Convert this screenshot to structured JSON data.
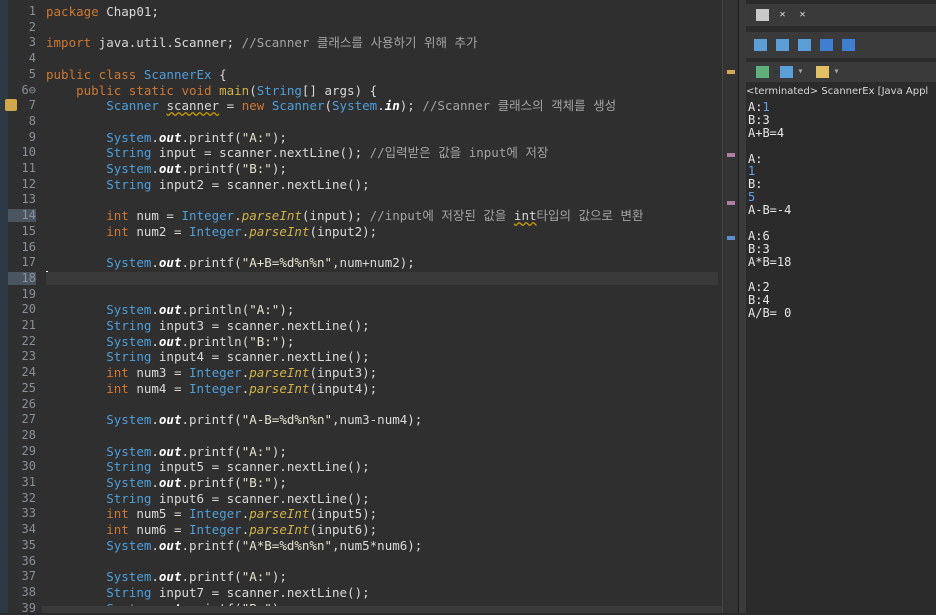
{
  "editor": {
    "lines": [
      {
        "n": "1",
        "code": "<span class=\"kw\">package</span> Chap01;"
      },
      {
        "n": "2",
        "code": ""
      },
      {
        "n": "3",
        "code": "<span class=\"kw\">import</span> java.util.Scanner; <span class=\"cm\">//Scanner 클래스를 사용하기 위해 추가</span>"
      },
      {
        "n": "4",
        "code": ""
      },
      {
        "n": "5",
        "code": "<span class=\"kw\">public class</span> <span class=\"ty\">ScannerEx</span> {"
      },
      {
        "n": "6⊖",
        "code": "    <span class=\"kw\">public static void</span> <span class=\"fn\">main</span>(<span class=\"ty\">String</span>[] args) {"
      },
      {
        "n": "7",
        "code": "        <span class=\"ty\">Scanner</span> <span class=\"var\">scanner</span> = <span class=\"kw\">new</span> <span class=\"ty\">Scanner</span>(<span class=\"ty\">System</span>.<span class=\"it\">in</span>); <span class=\"cm\">//Scanner 클래스의 객체를 생성</span>"
      },
      {
        "n": "8",
        "code": ""
      },
      {
        "n": "9",
        "code": "        <span class=\"ty\">System</span>.<span class=\"it\">out</span>.printf(<span class=\"st\">\"A:\"</span>);"
      },
      {
        "n": "10",
        "code": "        <span class=\"ty\">String</span> input = scanner.nextLine(); <span class=\"cm\">//입력받은 값을 input에 저장</span>"
      },
      {
        "n": "11",
        "code": "        <span class=\"ty\">System</span>.<span class=\"it\">out</span>.printf(<span class=\"st\">\"B:\"</span>);"
      },
      {
        "n": "12",
        "code": "        <span class=\"ty\">String</span> input2 = scanner.nextLine();"
      },
      {
        "n": "13",
        "code": ""
      },
      {
        "n": "14",
        "code": "        <span class=\"kw\">int</span> num = <span class=\"ty\">Integer</span>.<span class=\"it2\">parseInt</span>(input); <span class=\"cm\">//input에 저장된 값을 <span class=\"var\">int</span>타입의 값으로 변환</span>"
      },
      {
        "n": "15",
        "code": "        <span class=\"kw\">int</span> num2 = <span class=\"ty\">Integer</span>.<span class=\"it2\">parseInt</span>(input2);"
      },
      {
        "n": "16",
        "code": ""
      },
      {
        "n": "17",
        "code": "        <span class=\"ty\">System</span>.<span class=\"it\">out</span>.printf(<span class=\"st\">\"A+B=%d%n%n\"</span>,num+num2);"
      },
      {
        "n": "18",
        "code": "",
        "cur": true
      },
      {
        "n": "19",
        "code": ""
      },
      {
        "n": "20",
        "code": "        <span class=\"ty\">System</span>.<span class=\"it\">out</span>.println(<span class=\"st\">\"A:\"</span>);"
      },
      {
        "n": "21",
        "code": "        <span class=\"ty\">String</span> input3 = scanner.nextLine();"
      },
      {
        "n": "22",
        "code": "        <span class=\"ty\">System</span>.<span class=\"it\">out</span>.println(<span class=\"st\">\"B:\"</span>);"
      },
      {
        "n": "23",
        "code": "        <span class=\"ty\">String</span> input4 = scanner.nextLine();"
      },
      {
        "n": "24",
        "code": "        <span class=\"kw\">int</span> num3 = <span class=\"ty\">Integer</span>.<span class=\"it2\">parseInt</span>(input3);"
      },
      {
        "n": "25",
        "code": "        <span class=\"kw\">int</span> num4 = <span class=\"ty\">Integer</span>.<span class=\"it2\">parseInt</span>(input4);"
      },
      {
        "n": "26",
        "code": ""
      },
      {
        "n": "27",
        "code": "        <span class=\"ty\">System</span>.<span class=\"it\">out</span>.printf(<span class=\"st\">\"A-B=%d%n%n\"</span>,num3-num4);"
      },
      {
        "n": "28",
        "code": ""
      },
      {
        "n": "29",
        "code": "        <span class=\"ty\">System</span>.<span class=\"it\">out</span>.printf(<span class=\"st\">\"A:\"</span>);"
      },
      {
        "n": "30",
        "code": "        <span class=\"ty\">String</span> input5 = scanner.nextLine();"
      },
      {
        "n": "31",
        "code": "        <span class=\"ty\">System</span>.<span class=\"it\">out</span>.printf(<span class=\"st\">\"B:\"</span>);"
      },
      {
        "n": "32",
        "code": "        <span class=\"ty\">String</span> input6 = scanner.nextLine();"
      },
      {
        "n": "33",
        "code": "        <span class=\"kw\">int</span> num5 = <span class=\"ty\">Integer</span>.<span class=\"it2\">parseInt</span>(input5);"
      },
      {
        "n": "34",
        "code": "        <span class=\"kw\">int</span> num6 = <span class=\"ty\">Integer</span>.<span class=\"it2\">parseInt</span>(input6);"
      },
      {
        "n": "35",
        "code": "        <span class=\"ty\">System</span>.<span class=\"it\">out</span>.printf(<span class=\"st\">\"A*B=%d%n%n\"</span>,num5*num6);"
      },
      {
        "n": "36",
        "code": ""
      },
      {
        "n": "37",
        "code": "        <span class=\"ty\">System</span>.<span class=\"it\">out</span>.printf(<span class=\"st\">\"A:\"</span>);"
      },
      {
        "n": "38",
        "code": "        <span class=\"ty\">String</span> input7 = scanner.nextLine();"
      },
      {
        "n": "39",
        "code": "        <span class=\"ty\">System</span>.<span class=\"it\">out</span>.printf(<span class=\"st\">\"B:\"</span>);"
      }
    ]
  },
  "console": {
    "status": "<terminated> ScannerEx [Java Appl",
    "output": [
      {
        "t": "A:",
        "in": false
      },
      {
        "t": "1",
        "in": true,
        "prefix": "A:"
      },
      {
        "t": "B:3",
        "in": false
      },
      {
        "t": "A+B=4",
        "in": false
      },
      {
        "t": "",
        "in": false
      },
      {
        "t": "A:",
        "in": false
      },
      {
        "t": "1",
        "in": true
      },
      {
        "t": "B:",
        "in": false
      },
      {
        "t": "5",
        "in": true
      },
      {
        "t": "A-B=-4",
        "in": false
      },
      {
        "t": "",
        "in": false
      },
      {
        "t": "A:6",
        "in": false
      },
      {
        "t": "B:3",
        "in": false
      },
      {
        "t": "A*B=18",
        "in": false
      },
      {
        "t": "",
        "in": false
      },
      {
        "t": "A:2",
        "in": false
      },
      {
        "t": "B:4",
        "in": false
      },
      {
        "t": "A/B= 0",
        "in": false
      }
    ],
    "toolbar_icons": [
      "stop-icon",
      "remove-launch-icon",
      "remove-all-icon",
      "scroll-lock-icon",
      "word-wrap-icon",
      "show-console-icon",
      "pin-console-icon",
      "display-selected-icon",
      "open-console-icon"
    ]
  },
  "colors": {
    "editor_bg": "#2f2f2f",
    "keyword": "#cc7832",
    "type": "#4f9fd8",
    "method": "#d0b344",
    "comment": "#a3a3a3"
  }
}
